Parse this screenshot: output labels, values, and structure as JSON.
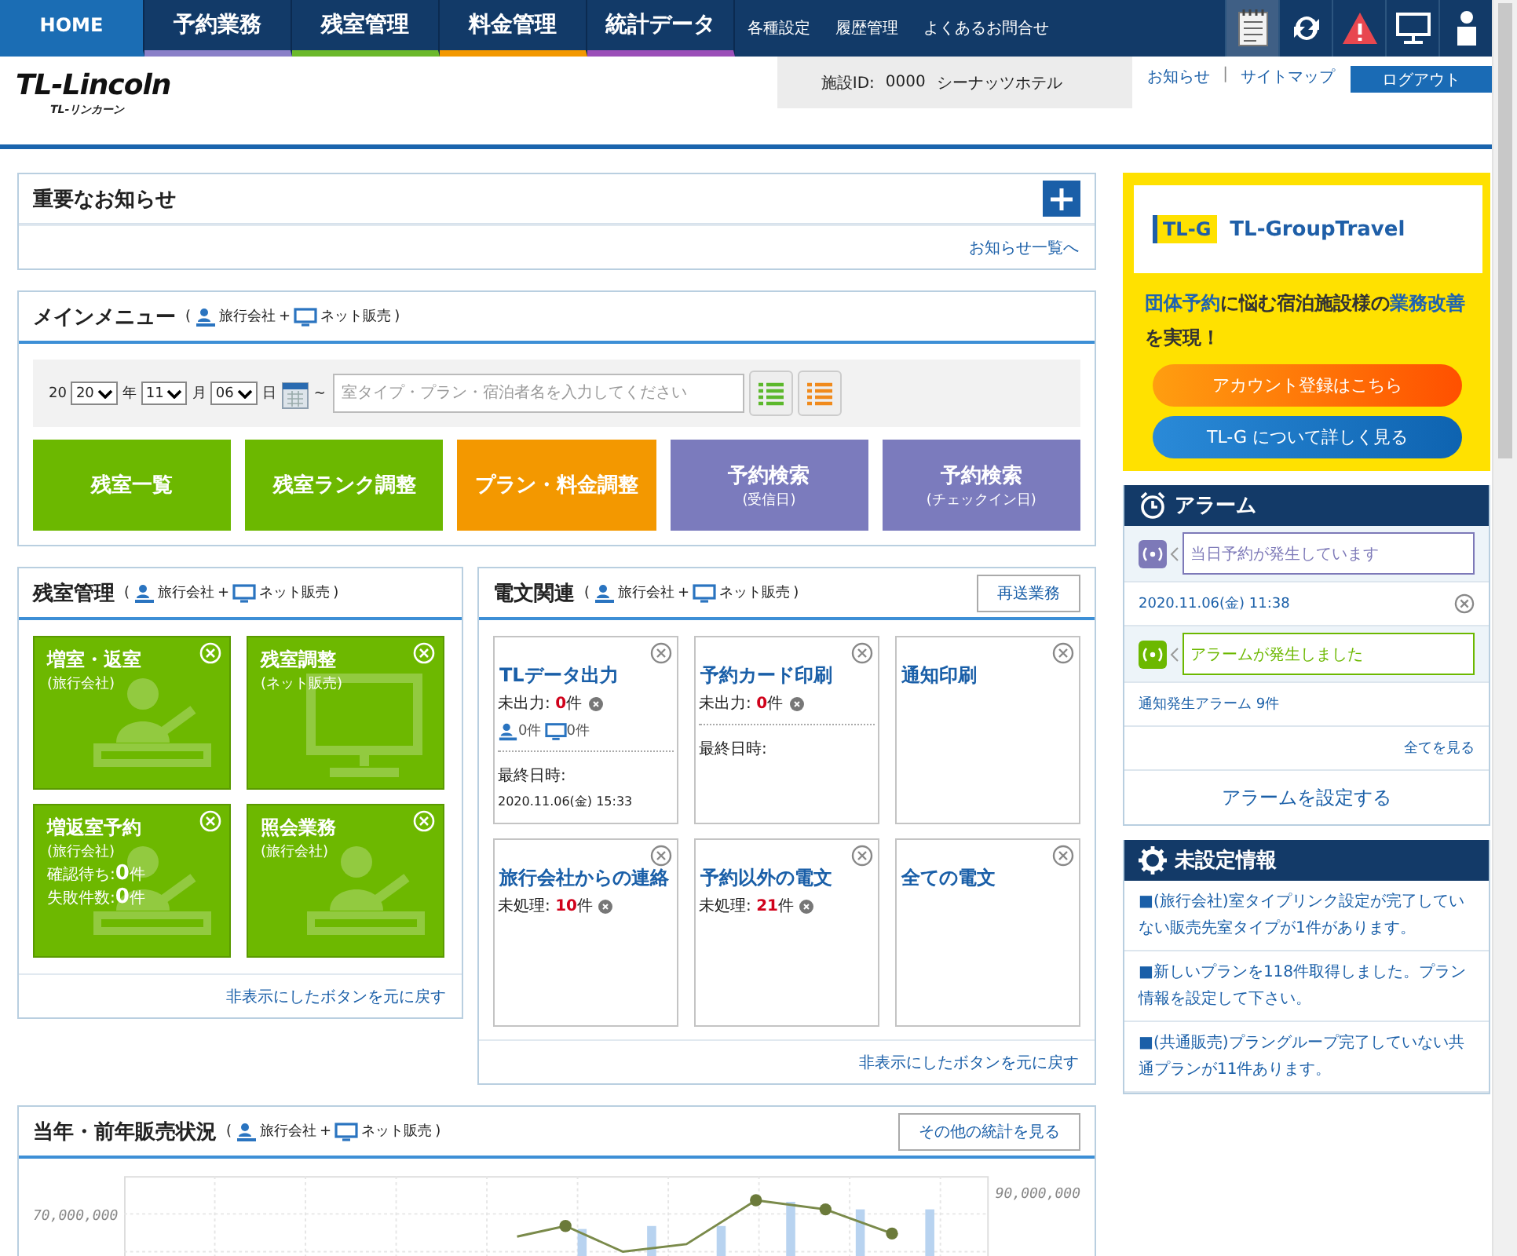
{
  "nav": {
    "tabs": [
      {
        "label": "HOME",
        "selected": true
      },
      {
        "label": "予約業務",
        "selected": false,
        "color": "#8a80c8"
      },
      {
        "label": "残室管理",
        "selected": false,
        "color": "#6cb92c"
      },
      {
        "label": "料金管理",
        "selected": false,
        "color": "#f39800"
      },
      {
        "label": "統計データ",
        "selected": false,
        "color": "#9b4fb8"
      }
    ],
    "links": [
      "各種設定",
      "履歴管理",
      "よくあるお問合せ"
    ]
  },
  "header": {
    "logo": "TL-Lincoln",
    "logo_sub": "TL-リンカーン",
    "facility_label": "施設ID:",
    "facility_id": "0000",
    "facility_name": "シーナッツホテル",
    "links": [
      "お知らせ",
      "サイトマップ"
    ],
    "separator": "|",
    "logout": "ログアウト"
  },
  "notice": {
    "title": "重要なお知らせ",
    "link": "お知らせ一覧へ"
  },
  "main_menu": {
    "title": "メインメニュー",
    "scope": {
      "open": "(",
      "agent": "旅行会社",
      "plus": "+",
      "net": "ネット販売",
      "close": ")"
    },
    "date": {
      "prefix": "20",
      "year": "20",
      "year_unit": "年",
      "month": "11",
      "month_unit": "月",
      "day": "06",
      "day_unit": "日",
      "tilde": "~"
    },
    "search": {
      "placeholder": "室タイプ・プラン・宿泊者名を入力してください"
    },
    "buttons": [
      {
        "label": "残室一覧",
        "color": "#6cb800"
      },
      {
        "label": "残室ランク調整",
        "color": "#6cb800"
      },
      {
        "label": "プラン・料金調整",
        "color": "#f39800"
      },
      {
        "label": "予約検索",
        "sub": "(受信日)",
        "color": "#7b7bbd"
      },
      {
        "label": "予約検索",
        "sub": "(チェックイン日)",
        "color": "#7b7bbd"
      }
    ]
  },
  "rooms": {
    "title": "残室管理",
    "scope": {
      "open": "(",
      "agent": "旅行会社",
      "plus": "+",
      "net": "ネット販売",
      "close": ")"
    },
    "tiles": [
      {
        "title": "増室・返室",
        "sub": "(旅行会社)",
        "kind": "person"
      },
      {
        "title": "残室調整",
        "sub": "(ネット販売)",
        "kind": "monitor"
      },
      {
        "title": "増返室予約",
        "sub": "(旅行会社)",
        "kind": "person",
        "counts": [
          {
            "label": "確認待ち:",
            "value": "0",
            "unit": "件"
          },
          {
            "label": "失敗件数:",
            "value": "0",
            "unit": "件"
          }
        ]
      },
      {
        "title": "照会業務",
        "sub": "(旅行会社)",
        "kind": "person"
      }
    ],
    "restore": "非表示にしたボタンを元に戻す"
  },
  "messages": {
    "title": "電文関連",
    "scope": {
      "open": "(",
      "agent": "旅行会社",
      "plus": "+",
      "net": "ネット販売",
      "close": ")"
    },
    "button": "再送業務",
    "cards": [
      {
        "title": "TLデータ出力",
        "status": {
          "label": "未出力:",
          "value": "0",
          "unit": "件"
        },
        "channels": [
          {
            "kind": "agent",
            "text": "0件"
          },
          {
            "kind": "net",
            "text": "0件"
          }
        ],
        "last": {
          "label": "最終日時:",
          "value": "2020.11.06(金) 15:33"
        }
      },
      {
        "title": "予約カード印刷",
        "status": {
          "label": "未出力:",
          "value": "0",
          "unit": "件"
        },
        "last": {
          "label": "最終日時:"
        }
      },
      {
        "title": "通知印刷"
      },
      {
        "title": "旅行会社からの連絡",
        "status": {
          "label": "未処理:",
          "value": "10",
          "unit": "件"
        }
      },
      {
        "title": "予約以外の電文",
        "status": {
          "label": "未処理:",
          "value": "21",
          "unit": "件"
        }
      },
      {
        "title": "全ての電文"
      }
    ],
    "restore": "非表示にしたボタンを元に戻す"
  },
  "sales": {
    "title": "当年・前年販売状況",
    "scope": {
      "open": "(",
      "agent": "旅行会社",
      "plus": "+",
      "net": "ネット販売",
      "close": ")"
    },
    "button": "その他の統計を見る",
    "left_tick": "70,000,000",
    "right_tick": "90,000,000"
  },
  "banner": {
    "logo_mark": "TL-G",
    "logo": "TL-GroupTravel",
    "headline": "**団体予約**に悩む宿泊施設様の**業務改善**を実現！",
    "buttons": [
      "アカウント登録はこちら",
      "TL-G について詳しく見る"
    ]
  },
  "alarm": {
    "title": "アラーム",
    "items": [
      {
        "kind": "bubble",
        "text": "当日予約が発生しています",
        "color": "#7d79b8"
      },
      {
        "kind": "time",
        "text": "2020.11.06(金) 11:38"
      },
      {
        "kind": "bubble",
        "text": "アラームが発生しました",
        "color": "#6cb800"
      },
      {
        "kind": "line",
        "text": "通知発生アラーム 9件"
      }
    ],
    "link": "全てを見る",
    "button": "アラームを設定する"
  },
  "unset": {
    "title": "未設定情報",
    "items": [
      "■(旅行会社)室タイプリンク設定が完了していない販売先室タイプが1件があります。",
      "■新しいプランを118件取得しました。プラン情報を設定して下さい。",
      "■(共通販売)プラングループ完了していない共通プランが11件あります。"
    ]
  }
}
